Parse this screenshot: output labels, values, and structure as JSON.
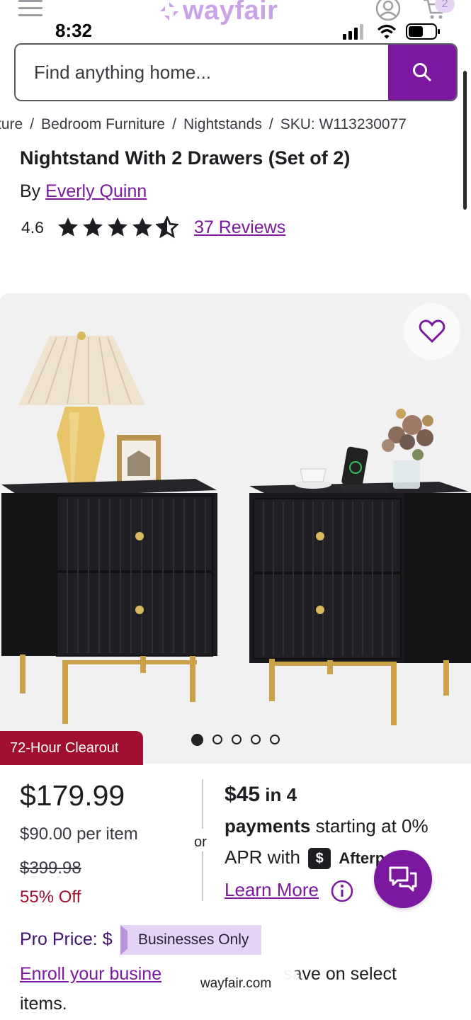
{
  "status_bar": {
    "time": "8:32"
  },
  "header": {
    "logo_text": "wayfair",
    "cart_count": "2",
    "brand_color": "#7b189f"
  },
  "search": {
    "placeholder": "Find anything home..."
  },
  "breadcrumb": [
    "ture",
    "Bedroom Furniture",
    "Nightstands",
    "SKU: W113230077"
  ],
  "product": {
    "title": "Nightstand With 2 Drawers (Set of 2)",
    "by_prefix": "By",
    "brand": "Everly Quinn",
    "rating": "4.6",
    "rating_value": 4.5,
    "reviews_label": "37 Reviews",
    "badge": "72-Hour Clearout",
    "image_count": 5,
    "active_image": 1
  },
  "pricing": {
    "price": "$179.99",
    "per_item": "$90.00 per item",
    "original_price": "$399.98",
    "discount": "55% Off",
    "or_label": "or"
  },
  "afterpay": {
    "amount": "$45",
    "in_4": "in 4",
    "payments": "payments",
    "starting": "starting at 0%",
    "apr_with": "APR with",
    "logo_text": "Afterp",
    "learn_more": "Learn More"
  },
  "pro": {
    "label": "Pro Price: $",
    "tag": "Businesses Only",
    "enroll_link": "Enroll your busine",
    "enroll_rest": "save on select",
    "enroll_end": "items."
  },
  "browser": {
    "url": "wayfair.com"
  }
}
